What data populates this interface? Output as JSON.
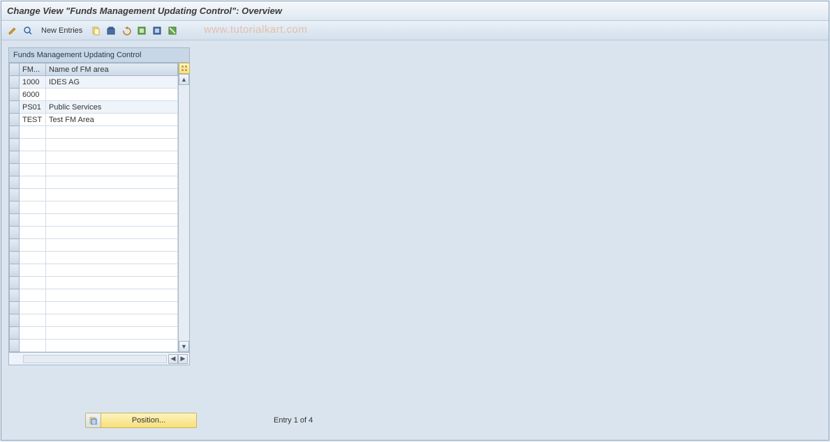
{
  "title": "Change View \"Funds Management Updating Control\": Overview",
  "toolbar": {
    "new_entries": "New Entries"
  },
  "watermark": "www.tutorialkart.com",
  "panel": {
    "title": "Funds Management Updating Control",
    "columns": {
      "fm": "FM...",
      "name": "Name of FM area"
    },
    "rows": [
      {
        "fm": "1000",
        "name": "IDES AG"
      },
      {
        "fm": "6000",
        "name": ""
      },
      {
        "fm": "PS01",
        "name": "Public Services"
      },
      {
        "fm": "TEST",
        "name": "Test FM Area"
      }
    ],
    "empty_rows": 18
  },
  "footer": {
    "position_label": "Position...",
    "entry_text": "Entry 1 of 4"
  }
}
